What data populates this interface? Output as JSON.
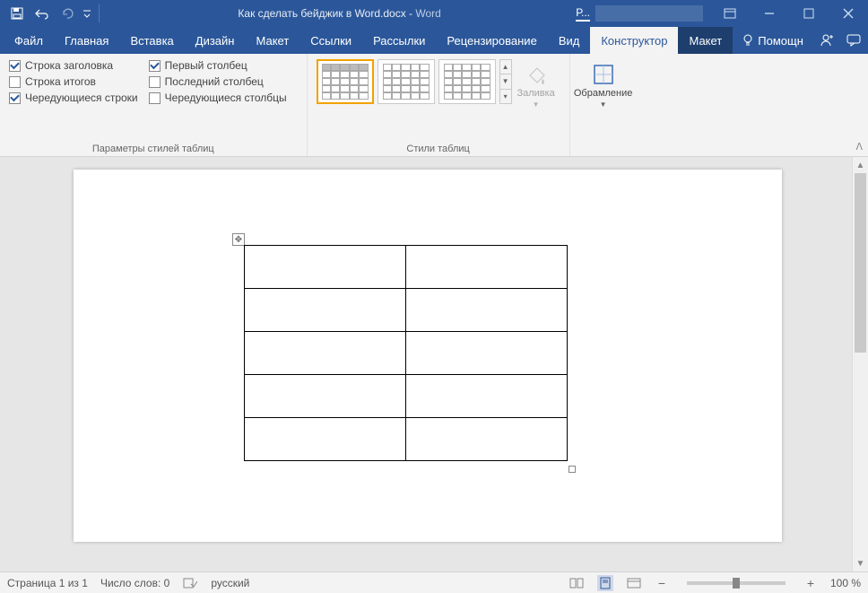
{
  "title": {
    "doc": "Как сделать бейджик в Word.docx",
    "sep": "  -  ",
    "app": "Word"
  },
  "contextual_tab_short": "Р...",
  "tabs": [
    "Файл",
    "Главная",
    "Вставка",
    "Дизайн",
    "Макет",
    "Ссылки",
    "Рассылки",
    "Рецензирование",
    "Вид",
    "Конструктор",
    "Макет"
  ],
  "active_tab_index": 9,
  "help_label": "Помощн",
  "ribbon": {
    "options_group_label": "Параметры стилей таблиц",
    "opts_col1": [
      {
        "label": "Строка заголовка",
        "checked": true
      },
      {
        "label": "Строка итогов",
        "checked": false
      },
      {
        "label": "Чередующиеся строки",
        "checked": true
      }
    ],
    "opts_col2": [
      {
        "label": "Первый столбец",
        "checked": true
      },
      {
        "label": "Последний столбец",
        "checked": false
      },
      {
        "label": "Чередующиеся столбцы",
        "checked": false
      }
    ],
    "styles_group_label": "Стили таблиц",
    "fill_label": "Заливка",
    "borders_label": "Обрамление"
  },
  "document": {
    "table_rows": 5,
    "table_cols": 2
  },
  "status": {
    "page": "Страница 1 из 1",
    "words": "Число слов: 0",
    "lang": "русский",
    "zoom": "100 %"
  }
}
